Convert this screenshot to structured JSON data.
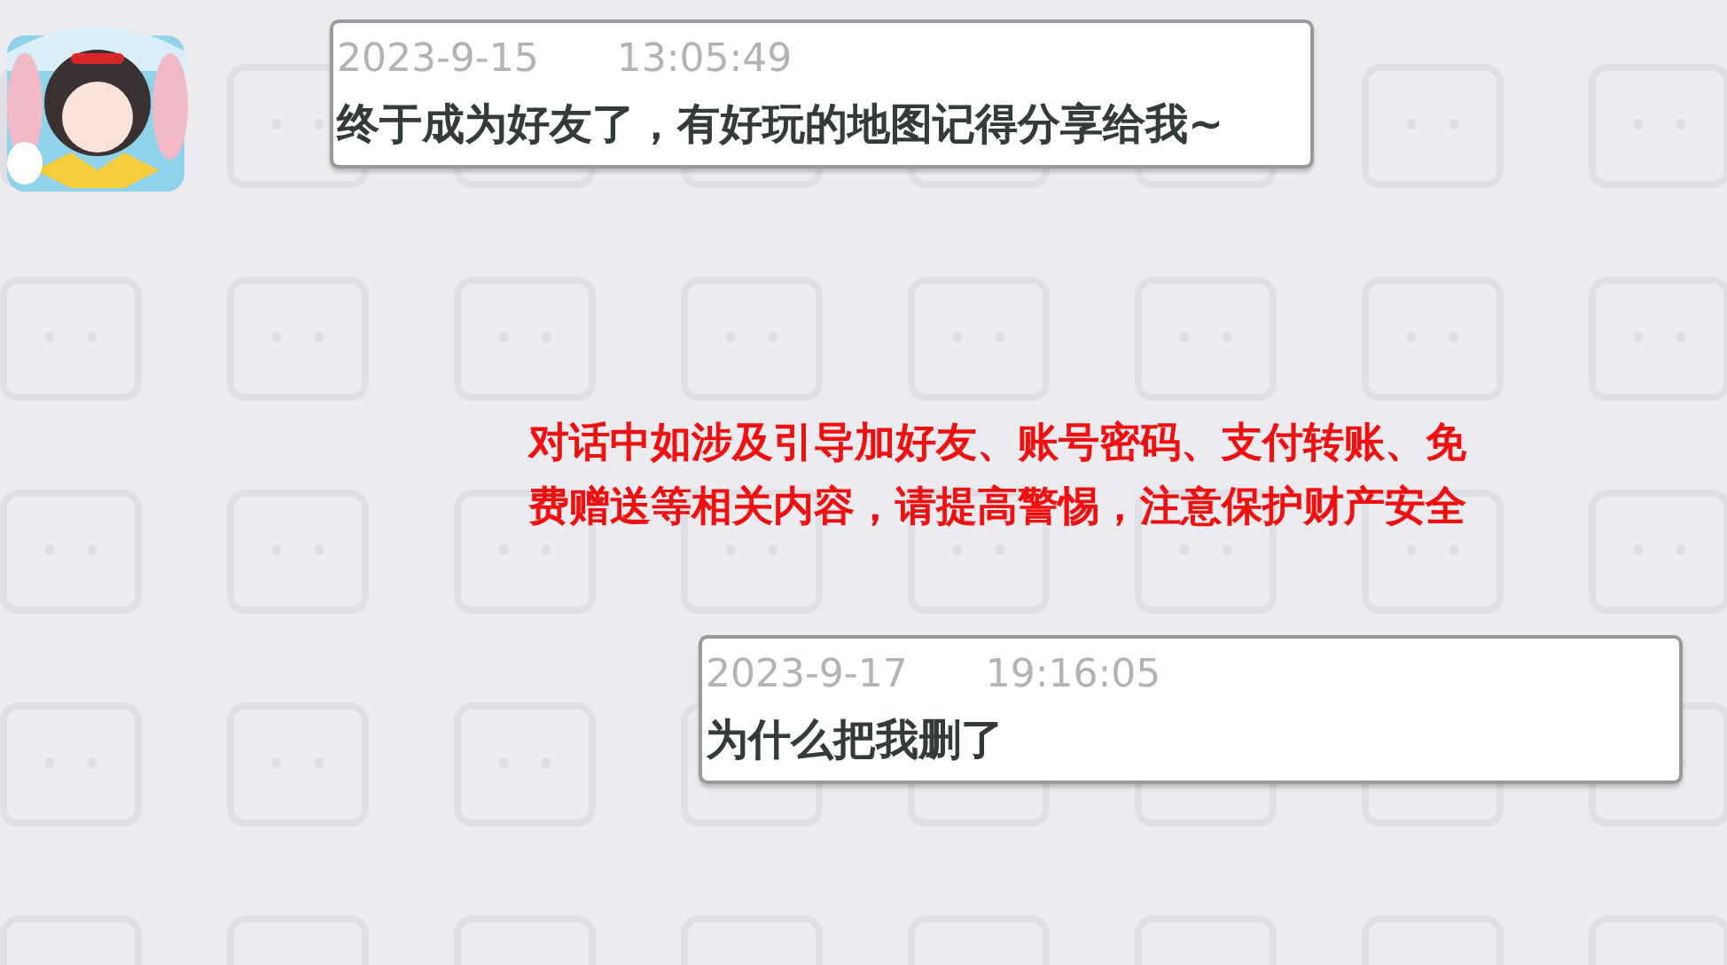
{
  "messages": [
    {
      "kind": "incoming",
      "date": "2023-9-15",
      "time": "13:05:49",
      "text": "终于成为好友了，有好玩的地图记得分享给我~"
    },
    {
      "kind": "notice",
      "text": "对话中如涉及引导加好友、账号密码、支付转账、免费赠送等相关内容，请提高警惕，注意保护财产安全"
    },
    {
      "kind": "outgoing",
      "date": "2023-9-17",
      "time": "19:16:05",
      "text": "为什么把我删了"
    }
  ]
}
